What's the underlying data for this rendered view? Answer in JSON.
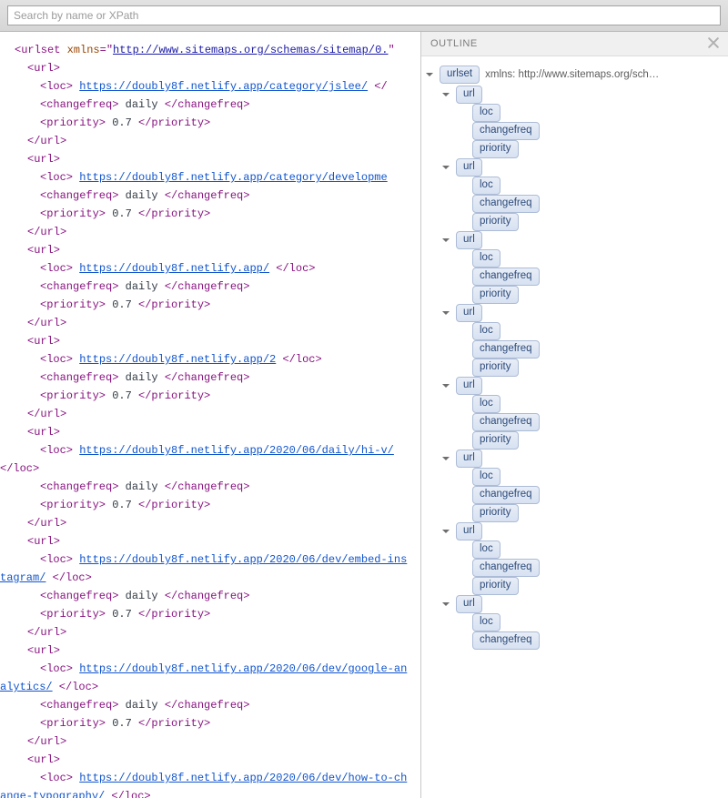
{
  "search": {
    "placeholder": "Search by name or XPath"
  },
  "xml": {
    "root_open_prefix": "<urlset ",
    "root_attr_name": "xmlns",
    "root_attr_value": "http://www.sitemaps.org/schemas/sitemap/0.",
    "root_open_suffix": "\"",
    "url_open": "<url>",
    "url_close": "</url>",
    "loc_open": "<loc>",
    "loc_close": "</loc>",
    "loc_close_cut": "</",
    "cf_open": "<changefreq>",
    "cf_close": "</changefreq>",
    "pr_open": "<priority>",
    "pr_close": "</priority>",
    "entries": [
      {
        "loc": "https://doubly8f.netlify.app/category/jslee/",
        "loc_trail_cut": true,
        "changefreq": "daily",
        "priority": "0.7",
        "wrap": false
      },
      {
        "loc": "https://doubly8f.netlify.app/category/developme",
        "loc_trail_cut": false,
        "loc_no_close": true,
        "changefreq": "daily",
        "priority": "0.7",
        "wrap": false
      },
      {
        "loc": "https://doubly8f.netlify.app/",
        "loc_trail_cut": false,
        "changefreq": "daily",
        "priority": "0.7",
        "wrap": false
      },
      {
        "loc": "https://doubly8f.netlify.app/2",
        "loc_trail_cut": false,
        "changefreq": "daily",
        "priority": "0.7",
        "wrap": false
      },
      {
        "loc": "https://doubly8f.netlify.app/2020/06/daily/hi-v/",
        "loc_trail_cut": false,
        "changefreq": "daily",
        "priority": "0.7",
        "wrap": true
      },
      {
        "loc": "https://doubly8f.netlify.app/2020/06/dev/embed-instagram/",
        "loc_trail_cut": false,
        "changefreq": "daily",
        "priority": "0.7",
        "wrap": true
      },
      {
        "loc": "https://doubly8f.netlify.app/2020/06/dev/google-analytics/",
        "loc_trail_cut": false,
        "changefreq": "daily",
        "priority": "0.7",
        "wrap": true
      }
    ],
    "trailing": {
      "url_open": "<url>",
      "loc_open": "<loc>",
      "loc": "https://doubly8f.netlify.app/2020/06/dev/how-to-change-typography/",
      "loc_close": "</loc>"
    }
  },
  "outline": {
    "title": "OUTLINE",
    "root": {
      "pill": "urlset",
      "attr": "xmlns: http://www.sitemaps.org/sch…"
    },
    "url_label": "url",
    "children": [
      "loc",
      "changefreq",
      "priority"
    ],
    "url_count": 7,
    "trailing_url_children": [
      "loc",
      "changefreq"
    ]
  }
}
